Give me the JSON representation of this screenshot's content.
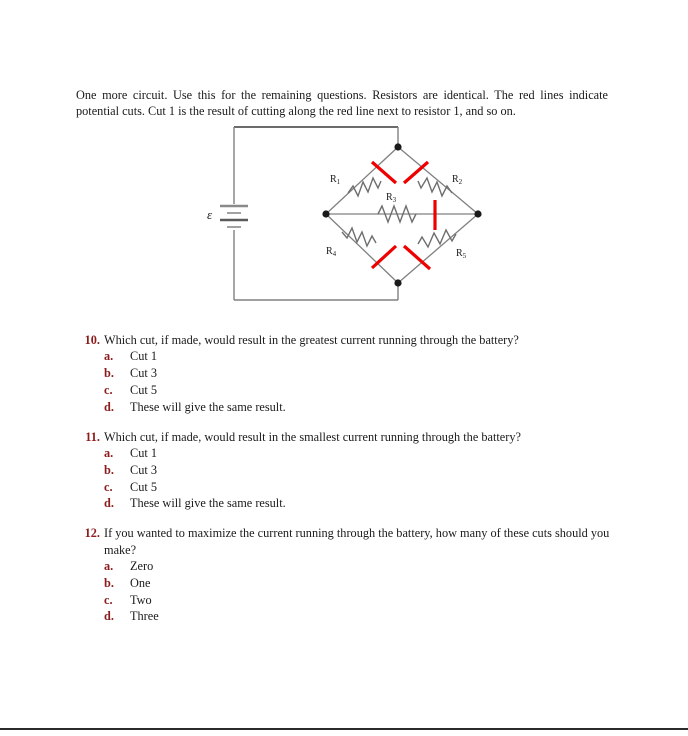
{
  "document": {
    "intro": "One more circuit. Use this for the remaining questions. Resistors are identical. The red lines indicate potential cuts. Cut 1 is the result of cutting along the red line next to resistor 1, and so on."
  },
  "figure": {
    "name": "wheatstone-bridge-circuit",
    "battery_label": "ε",
    "resistor_labels": [
      "R",
      "R",
      "R",
      "R",
      "R"
    ],
    "resistor_subscripts": [
      "1",
      "2",
      "3",
      "4",
      "5"
    ],
    "cut_color": "#ee0000",
    "wire_color": "#808080",
    "node_color": "#1a1a1a"
  },
  "questions": [
    {
      "number": "10.",
      "text": "Which cut, if made, would result in the greatest current running through the battery?",
      "choices": [
        {
          "letter": "a.",
          "text": "Cut 1"
        },
        {
          "letter": "b.",
          "text": "Cut 3"
        },
        {
          "letter": "c.",
          "text": "Cut 5"
        },
        {
          "letter": "d.",
          "text": "These will give the same result."
        }
      ]
    },
    {
      "number": "11.",
      "text": "Which cut, if made, would result in the smallest current running through the battery?",
      "choices": [
        {
          "letter": "a.",
          "text": "Cut 1"
        },
        {
          "letter": "b.",
          "text": "Cut 3"
        },
        {
          "letter": "c.",
          "text": "Cut 5"
        },
        {
          "letter": "d.",
          "text": "These will give the same result."
        }
      ]
    },
    {
      "number": "12.",
      "text": "If you wanted to maximize the current running through the battery, how many of these cuts should you make?",
      "choices": [
        {
          "letter": "a.",
          "text": "Zero"
        },
        {
          "letter": "b.",
          "text": "One"
        },
        {
          "letter": "c.",
          "text": "Two"
        },
        {
          "letter": "d.",
          "text": "Three"
        }
      ]
    }
  ]
}
